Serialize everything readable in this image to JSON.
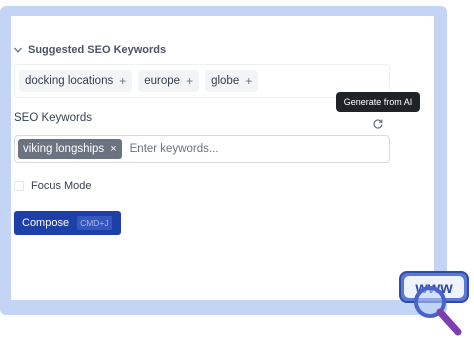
{
  "suggested": {
    "header": "Suggested SEO Keywords",
    "chips": [
      {
        "label": "docking locations",
        "icon": "+"
      },
      {
        "label": "europe",
        "icon": "+"
      },
      {
        "label": "globe",
        "icon": "+"
      }
    ]
  },
  "seo": {
    "label": "SEO Keywords",
    "tooltip": "Generate from AI",
    "chips": [
      {
        "label": "viking longships",
        "remove": "×"
      }
    ],
    "placeholder": "Enter keywords..."
  },
  "focus": {
    "label": "Focus Mode",
    "checked": false
  },
  "compose": {
    "label": "Compose",
    "shortcut": "CMD+J"
  },
  "decor": {
    "badge_text": "www"
  },
  "colors": {
    "accent": "#1d3fa8",
    "frame": "#c3d4f5",
    "tooltip_bg": "#1f2328",
    "chip": "#6b7280"
  }
}
